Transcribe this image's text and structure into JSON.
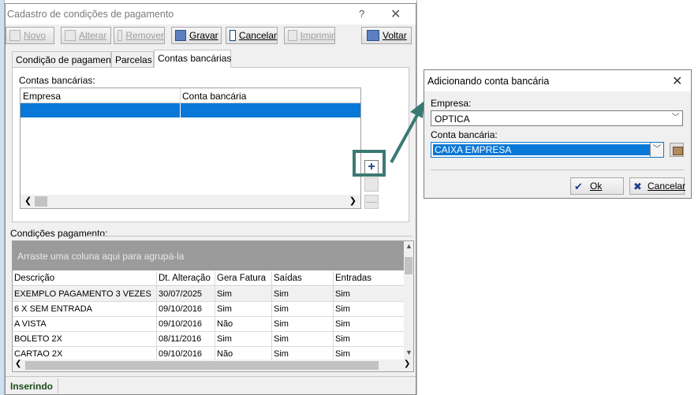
{
  "window": {
    "title": "Cadastro de condições de pagamento",
    "help_glyph": "?",
    "close_glyph": "✕"
  },
  "toolbar": {
    "novo": "Novo",
    "alterar": "Alterar",
    "remover": "Remover",
    "gravar": "Gravar",
    "cancelar": "Cancelar",
    "imprimir": "Imprimir",
    "voltar": "Voltar"
  },
  "tabs": [
    "Condição de pagamento",
    "Parcelas",
    "Contas bancárias"
  ],
  "contas": {
    "label": "Contas bancárias:",
    "col_empresa": "Empresa",
    "col_conta": "Conta bancária",
    "add_glyph": "+",
    "remove_glyph": "—"
  },
  "condicoes": {
    "label": "Condições pagamento:",
    "group_hint": "Arraste uma coluna aqui para agrupá-la",
    "columns": [
      "Descrição",
      "Dt. Alteração",
      "Gera Fatura",
      "Saídas",
      "Entradas"
    ],
    "rows": [
      [
        "EXEMPLO PAGAMENTO 3 VEZES",
        "30/07/2025",
        "Sim",
        "Sim",
        "Sim"
      ],
      [
        "6 X SEM ENTRADA",
        "09/10/2016",
        "Sim",
        "Sim",
        "Sim"
      ],
      [
        "A VISTA",
        "09/10/2016",
        "Não",
        "Sim",
        "Sim"
      ],
      [
        "BOLETO 2X",
        "08/11/2016",
        "Sim",
        "Sim",
        "Sim"
      ],
      [
        "CARTAO 2X",
        "09/10/2016",
        "Não",
        "Sim",
        "Sim"
      ]
    ]
  },
  "status": {
    "mode": "Inserindo"
  },
  "dialog": {
    "title": "Adicionando conta bancária",
    "close_glyph": "✕",
    "empresa_label": "Empresa:",
    "empresa_value": "OPTICA",
    "conta_label": "Conta bancária:",
    "conta_value": "CAIXA EMPRESA",
    "ok": "Ok",
    "cancelar": "Cancelar"
  },
  "colors": {
    "selection": "#0a78d7",
    "highlight": "#3a7a74"
  }
}
